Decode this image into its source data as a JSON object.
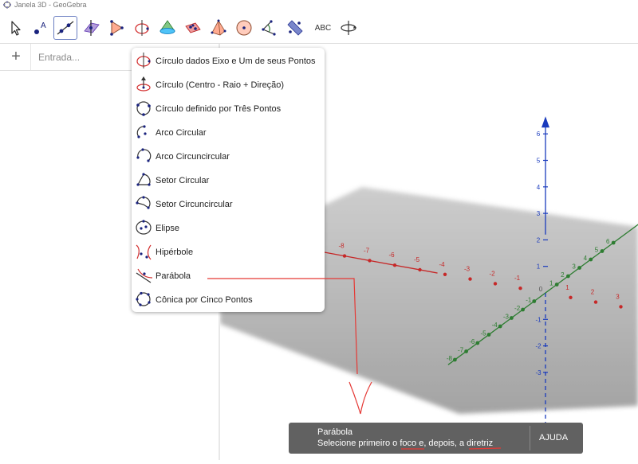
{
  "window": {
    "title": "Janela 3D - GeoGebra"
  },
  "toolbar": {
    "tools": [
      {
        "name": "move-tool-button",
        "icon": "cursor-icon",
        "selected": false
      },
      {
        "name": "point-tool-button",
        "icon": "point-icon",
        "selected": false
      },
      {
        "name": "line-tool-button",
        "icon": "line-icon",
        "selected": true
      },
      {
        "name": "perpendicular-tool-button",
        "icon": "perpendicular-icon",
        "selected": false
      },
      {
        "name": "polygon-tool-button",
        "icon": "polygon-icon",
        "selected": false
      },
      {
        "name": "circle-tool-button",
        "icon": "circle-axis-icon",
        "selected": false
      },
      {
        "name": "intersect-tool-button",
        "icon": "cone-icon",
        "selected": false
      },
      {
        "name": "plane-tool-button",
        "icon": "plane-icon",
        "selected": false
      },
      {
        "name": "pyramid-tool-button",
        "icon": "pyramid-icon",
        "selected": false
      },
      {
        "name": "sphere-tool-button",
        "icon": "sphere-icon",
        "selected": false
      },
      {
        "name": "angle-tool-button",
        "icon": "angle-icon",
        "selected": false
      },
      {
        "name": "reflect-tool-button",
        "icon": "reflect-icon",
        "selected": false
      },
      {
        "name": "text-tool-button",
        "icon": "text-icon",
        "label": "ABC",
        "selected": false
      },
      {
        "name": "rotate-view-tool-button",
        "icon": "rotate-view-icon",
        "selected": false
      }
    ]
  },
  "algebra": {
    "input_placeholder": "Entrada..."
  },
  "menu": {
    "items": [
      {
        "label": "Círculo dados Eixo e Um de seus Pontos",
        "icon": "circle-axis-point-icon"
      },
      {
        "label": "Círculo (Centro - Raio + Direção)",
        "icon": "circle-center-radius-icon"
      },
      {
        "label": "Círculo definido por Três Pontos",
        "icon": "circle-three-points-icon"
      },
      {
        "label": "Arco Circular",
        "icon": "circular-arc-icon"
      },
      {
        "label": "Arco Circuncircular",
        "icon": "circumcircular-arc-icon"
      },
      {
        "label": "Setor Circular",
        "icon": "circular-sector-icon"
      },
      {
        "label": "Setor Circuncircular",
        "icon": "circumcircular-sector-icon"
      },
      {
        "label": "Elipse",
        "icon": "ellipse-icon"
      },
      {
        "label": "Hipérbole",
        "icon": "hyperbola-icon"
      },
      {
        "label": "Parábola",
        "icon": "parabola-icon"
      },
      {
        "label": "Cônica por Cinco Pontos",
        "icon": "conic-five-points-icon"
      }
    ]
  },
  "graphics": {
    "x_ticks": [
      "-8",
      "-7",
      "-6",
      "-5",
      "-4",
      "-3",
      "-2",
      "-1",
      "1",
      "2",
      "3"
    ],
    "y_ticks": [
      "-8",
      "-7",
      "-6",
      "-5",
      "-4",
      "-3",
      "-2",
      "-1",
      "1",
      "2",
      "3",
      "4",
      "5",
      "6"
    ],
    "z_ticks": [
      "6",
      "5",
      "4",
      "3",
      "2",
      "1",
      "-1",
      "-2",
      "-3"
    ],
    "origin_label": "0",
    "colors": {
      "x_axis": "#c62828",
      "y_axis": "#2e7d32",
      "z_axis": "#1a3bbd",
      "plane": "#9e9e9e"
    }
  },
  "tooltip": {
    "title": "Parábola",
    "text_prefix": "Selecione primeiro o ",
    "word_focus": "foco",
    "text_middle": " e, depois, a ",
    "word_directrix": "diretriz",
    "help_label": "AJUDA"
  },
  "annotation": {
    "color": "#e53935"
  }
}
